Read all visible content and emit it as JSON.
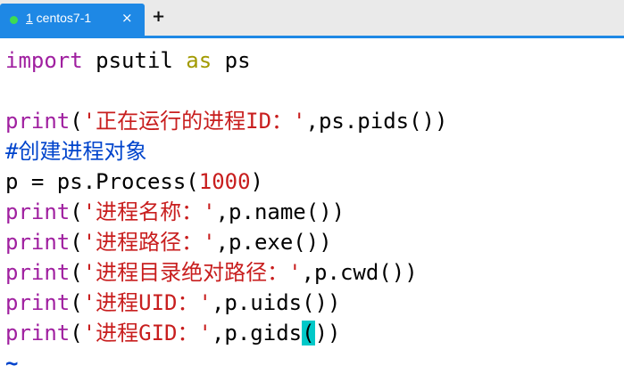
{
  "tab": {
    "number": "1",
    "name": " centos7-1",
    "close_symbol": "×",
    "new_tab_symbol": "+",
    "status_color": "#3ddc52",
    "accent": "#1e88e5"
  },
  "code": {
    "l1": {
      "kw_import": "import",
      "mod": " psutil ",
      "kw_as": "as",
      "alias": " ps"
    },
    "l3": {
      "fn": "print",
      "open": "(",
      "str": "'正在运行的进程ID：'",
      "rest": ",ps.pids())"
    },
    "l4": {
      "comment": "#创建进程对象"
    },
    "l5": {
      "pre": "p = ps.Process(",
      "num": "1000",
      "post": ")"
    },
    "l6": {
      "fn": "print",
      "open": "(",
      "str": "'进程名称：'",
      "rest": ",p.name())"
    },
    "l7": {
      "fn": "print",
      "open": "(",
      "str": "'进程路径：'",
      "rest": ",p.exe())"
    },
    "l8": {
      "fn": "print",
      "open": "(",
      "str": "'进程目录绝对路径：'",
      "rest": ",p.cwd())"
    },
    "l9": {
      "fn": "print",
      "open": "(",
      "str": "'进程UID：'",
      "rest": ",p.uids())"
    },
    "l10": {
      "fn": "print",
      "open": "(",
      "str": "'进程GID：'",
      "rest": ",p.gids",
      "cursor_char": "(",
      "after": "))"
    },
    "l11": {
      "tilde": "~"
    }
  }
}
